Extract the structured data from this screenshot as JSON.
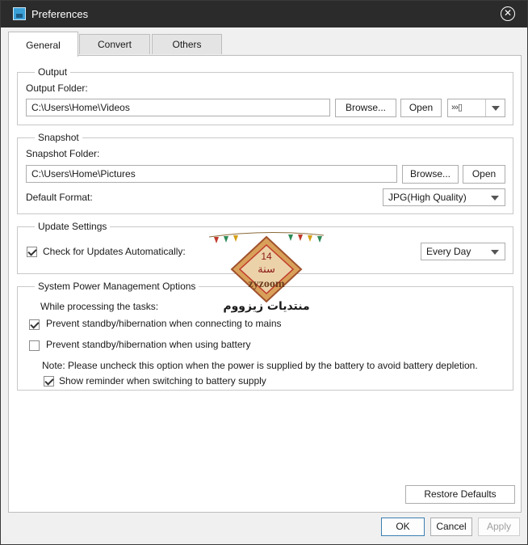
{
  "window": {
    "title": "Preferences",
    "close_glyph": "✕"
  },
  "tabs": [
    {
      "label": "General",
      "active": true
    },
    {
      "label": "Convert",
      "active": false
    },
    {
      "label": "Others",
      "active": false
    }
  ],
  "output": {
    "legend": "Output",
    "folder_label": "Output Folder:",
    "folder_value": "C:\\Users\\Home\\Videos",
    "browse_label": "Browse...",
    "open_label": "Open",
    "device_glyphs": "›››▯"
  },
  "snapshot": {
    "legend": "Snapshot",
    "folder_label": "Snapshot Folder:",
    "folder_value": "C:\\Users\\Home\\Pictures",
    "browse_label": "Browse...",
    "open_label": "Open",
    "format_label": "Default Format:",
    "format_value": "JPG(High Quality)"
  },
  "update": {
    "legend": "Update Settings",
    "check_label": "Check for Updates Automatically:",
    "checked": true,
    "frequency_value": "Every Day"
  },
  "power": {
    "legend": "System Power Management Options",
    "intro": "While processing the tasks:",
    "mains_label": "Prevent standby/hibernation when connecting to mains",
    "mains_checked": true,
    "battery_label": "Prevent standby/hibernation when using battery",
    "battery_checked": false,
    "note": "Note: Please uncheck this option when the power is supplied by the battery to avoid battery depletion.",
    "reminder_label": "Show reminder when switching to battery supply",
    "reminder_checked": true
  },
  "actions": {
    "restore_label": "Restore Defaults",
    "ok_label": "OK",
    "cancel_label": "Cancel",
    "apply_label": "Apply"
  },
  "watermark": {
    "number": "14",
    "word": "سنة",
    "brand": "zyzoom",
    "arabic": "منتديات زيزووم"
  },
  "colors": {
    "titlebar": "#2b2b2b",
    "ok_border": "#3c7fb1"
  }
}
